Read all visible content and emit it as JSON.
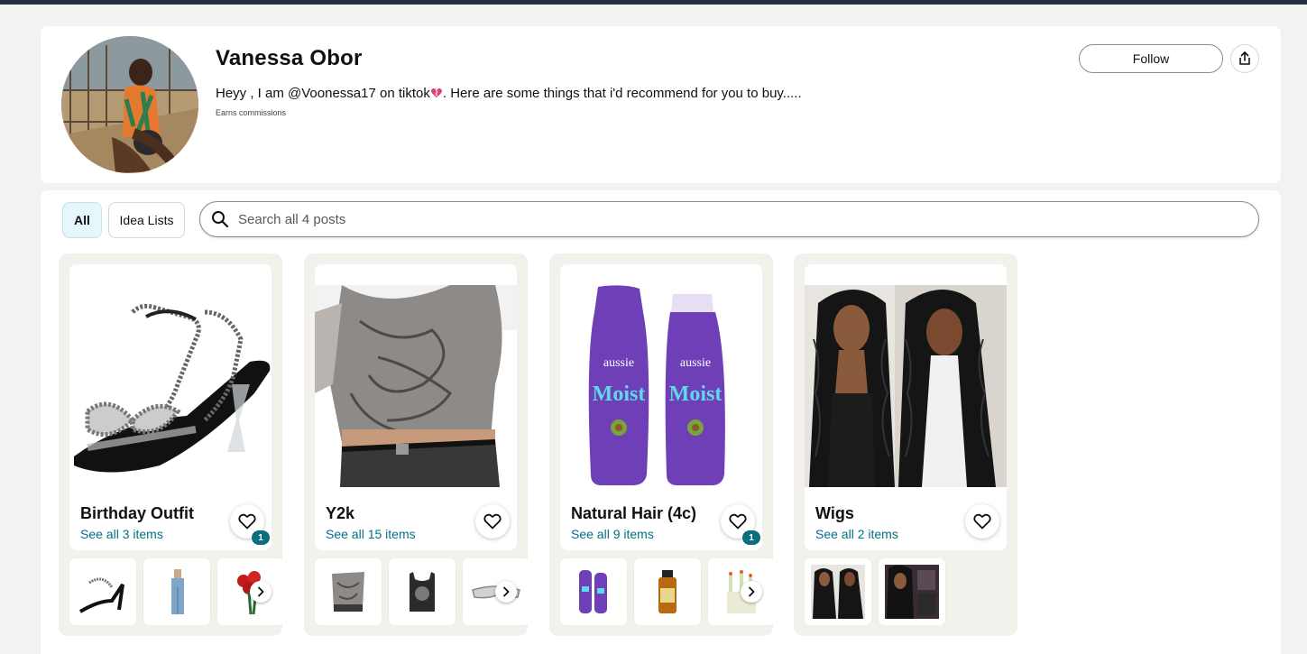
{
  "profile": {
    "name": "Vanessa Obor",
    "bio_before": "Heyy , I am @Voonessa17 on tiktok",
    "bio_after": ". Here are some things that i'd recommend for you to buy.....",
    "earns": "Earns commissions",
    "follow_label": "Follow"
  },
  "filters": {
    "all_label": "All",
    "ideas_label": "Idea Lists"
  },
  "search": {
    "placeholder": "Search all 4 posts"
  },
  "colors": {
    "link": "#007185",
    "badge": "#0b6e7f",
    "card_bg": "#f3f1ec",
    "active_tab": "#e6f7fb"
  },
  "posts": [
    {
      "title": "Birthday Outfit",
      "link": "See all 3 items",
      "badge": "1"
    },
    {
      "title": "Y2k",
      "link": "See all 15 items"
    },
    {
      "title": "Natural Hair (4c)",
      "link": "See all 9 items",
      "badge": "1"
    },
    {
      "title": "Wigs",
      "link": "See all 2 items"
    }
  ]
}
